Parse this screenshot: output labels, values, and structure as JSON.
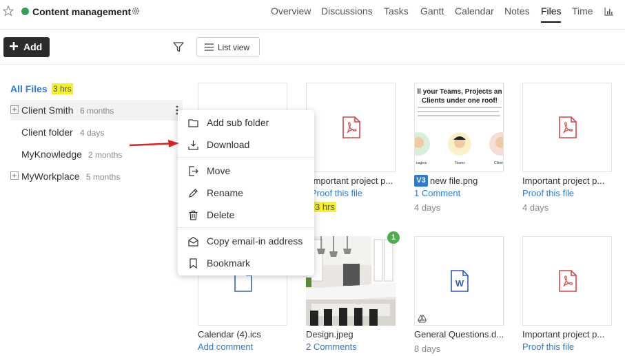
{
  "header": {
    "project_name": "Content management",
    "project_dot_color": "#2ea44f",
    "tabs": [
      {
        "label": "Overview"
      },
      {
        "label": "Discussions"
      },
      {
        "label": "Tasks"
      },
      {
        "label": "Gantt"
      },
      {
        "label": "Calendar"
      },
      {
        "label": "Notes"
      },
      {
        "label": "Files",
        "active": true
      },
      {
        "label": "Time"
      }
    ]
  },
  "toolbar": {
    "add_label": "Add",
    "listview_label": "List view"
  },
  "tree": {
    "all_files_label": "All Files",
    "all_files_time": "3 hrs",
    "items": [
      {
        "name": "Client Smith",
        "age": "6 months",
        "expandable": true
      },
      {
        "name": "Client folder",
        "age": "4 days",
        "expandable": false
      },
      {
        "name": "MyKnowledge",
        "age": "2 months",
        "expandable": false
      },
      {
        "name": "MyWorkplace",
        "age": "5 months",
        "expandable": true
      }
    ]
  },
  "context_menu": {
    "items": [
      {
        "label": "Add sub folder",
        "icon": "folder-icon"
      },
      {
        "label": "Download",
        "icon": "download-icon"
      },
      {
        "label": "Move",
        "icon": "move-icon"
      },
      {
        "label": "Rename",
        "icon": "pencil-icon"
      },
      {
        "label": "Delete",
        "icon": "trash-icon"
      },
      {
        "label": "Copy email-in address",
        "icon": "envelope-icon"
      },
      {
        "label": "Bookmark",
        "icon": "bookmark-icon"
      }
    ]
  },
  "files": [
    {
      "name": "Important project p...",
      "link": "Proof this file",
      "time": "3 hrs",
      "icon": "pdf-icon"
    },
    {
      "name": "new file.png",
      "version": "V3",
      "link": "1 Comment",
      "time": "4 days",
      "thumbnail_text": [
        "ll your Teams, Projects an",
        "Clients under one roof!"
      ],
      "thumbnail_labels": [
        "nagers",
        "Teams",
        "Client"
      ]
    },
    {
      "name": "Important project p...",
      "link": "Proof this file",
      "time": "4 days",
      "icon": "pdf-icon"
    },
    {
      "name": "Calendar (4).ics",
      "link": "Add comment",
      "icon": "file-icon"
    },
    {
      "name": "Design.jpeg",
      "link": "2 Comments",
      "badge": "1",
      "icon": "photo"
    },
    {
      "name": "General Questions.d...",
      "time": "8 days",
      "icon": "word-icon",
      "badge_glyph": "W"
    },
    {
      "name": "Important project p...",
      "link": "Proof this file",
      "icon": "pdf-icon"
    }
  ],
  "colors": {
    "accent_blue": "#2a7ad8",
    "highlight_yellow": "#f7f021",
    "pdf_red": "#d24545",
    "word_blue": "#2b5cbf",
    "arrow_red": "#e02020",
    "badge_green": "#4cae4c"
  }
}
